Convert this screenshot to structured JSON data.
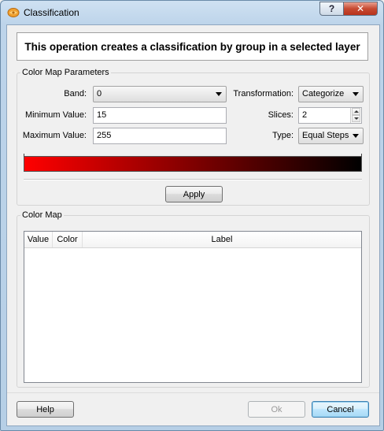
{
  "window": {
    "title": "Classification",
    "help_glyph": "?",
    "close_glyph": "✕"
  },
  "banner": {
    "text": "This operation creates a classification by group in a selected layer"
  },
  "color_map_parameters": {
    "group_title": "Color Map Parameters",
    "band": {
      "label": "Band:",
      "value": "0"
    },
    "minimum": {
      "label": "Minimum Value:",
      "value": "15"
    },
    "maximum": {
      "label": "Maximum Value:",
      "value": "255"
    },
    "transformation": {
      "label": "Transformation:",
      "value": "Categorize"
    },
    "slices": {
      "label": "Slices:",
      "value": "2"
    },
    "type": {
      "label": "Type:",
      "value": "Equal Steps"
    },
    "gradient": {
      "start_color": "#ff0000",
      "end_color": "#000000"
    },
    "apply_label": "Apply"
  },
  "color_map": {
    "group_title": "Color Map",
    "columns": [
      "Value",
      "Color",
      "Label"
    ],
    "rows": []
  },
  "footer": {
    "help_label": "Help",
    "ok_label": "Ok",
    "cancel_label": "Cancel"
  }
}
